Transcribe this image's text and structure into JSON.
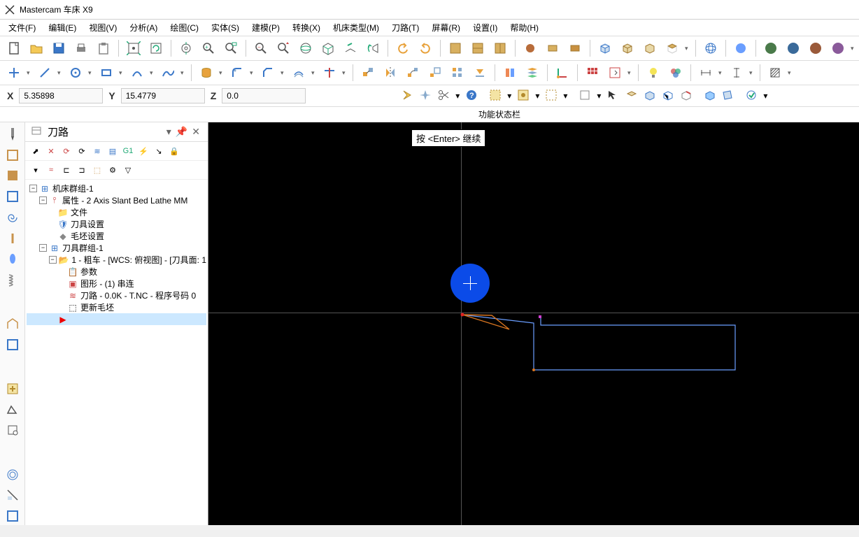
{
  "title": "Mastercam 车床 X9",
  "menu": [
    "文件(F)",
    "编辑(E)",
    "视图(V)",
    "分析(A)",
    "绘图(C)",
    "实体(S)",
    "建模(P)",
    "转换(X)",
    "机床类型(M)",
    "刀路(T)",
    "屏幕(R)",
    "设置(I)",
    "帮助(H)"
  ],
  "coords": {
    "x_label": "X",
    "x": "5.35898",
    "y_label": "Y",
    "y": "15.4779",
    "z_label": "Z",
    "z": "0.0"
  },
  "status_label": "功能状态栏",
  "panel": {
    "title": "刀路"
  },
  "tree": {
    "machine_group": "机床群组-1",
    "properties": "属性 - 2 Axis Slant Bed Lathe MM",
    "files": "文件",
    "tool_settings": "刀具设置",
    "stock_settings": "毛坯设置",
    "toolpath_group": "刀具群组-1",
    "op1": "1 - 粗车 - [WCS: 俯视图] - [刀具面: 1",
    "params": "参数",
    "geom": "图形 - (1) 串连",
    "tp": "刀路 - 0.0K - T.NC - 程序号码 0",
    "update_stock": "更新毛坯"
  },
  "viewport_prompt": "按 <Enter> 继续",
  "colors": {
    "accent": "#0b4be8",
    "geom": "#6a9eff",
    "tool": "#d87520"
  }
}
